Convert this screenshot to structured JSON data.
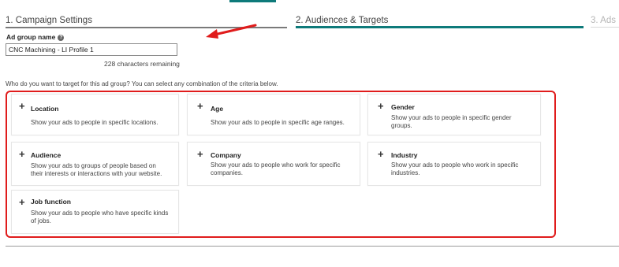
{
  "steps": [
    {
      "label": "1. Campaign Settings"
    },
    {
      "label": "2. Audiences & Targets"
    },
    {
      "label": "3. Ads"
    }
  ],
  "ad_group": {
    "label": "Ad group name",
    "help_icon": "question-circle-icon",
    "value": "CNC Machining - LI Profile 1",
    "chars_remaining": "228 characters remaining"
  },
  "targeting_prompt": "Who do you want to target for this ad group? You can select any combination of the criteria below.",
  "criteria": [
    {
      "title": "Location",
      "desc": "Show your ads to people in specific locations."
    },
    {
      "title": "Age",
      "desc": "Show your ads to people in specific age ranges."
    },
    {
      "title": "Gender",
      "desc": "Show your ads to people in specific gender groups."
    },
    {
      "title": "Audience",
      "desc": "Show your ads to groups of people based on their interests or interactions with your website."
    },
    {
      "title": "Company",
      "desc": "Show your ads to people who work for specific companies."
    },
    {
      "title": "Industry",
      "desc": "Show your ads to people who work in specific industries."
    },
    {
      "title": "Job function",
      "desc": "Show your ads to people who have specific kinds of jobs."
    }
  ],
  "colors": {
    "accent": "#0e7a7a",
    "highlight": "#e01c1c"
  }
}
